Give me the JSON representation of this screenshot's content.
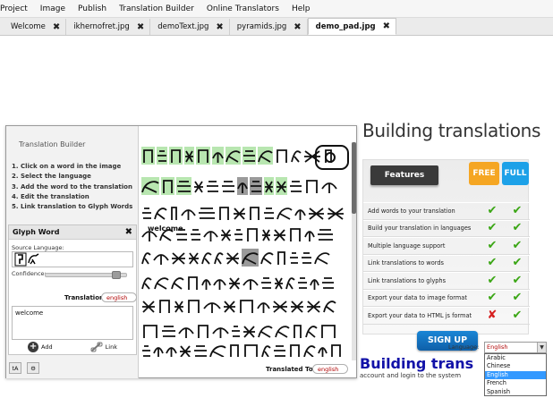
{
  "menu": [
    "Project",
    "Image",
    "Publish",
    "Translation Builder",
    "Online Translators",
    "Help"
  ],
  "tabs": [
    {
      "label": "Welcome",
      "active": false
    },
    {
      "label": "ikhernofret.jpg",
      "active": false
    },
    {
      "label": "demoText.jpg",
      "active": false
    },
    {
      "label": "pyramids.jpg",
      "active": false
    },
    {
      "label": "demo_pad.jpg",
      "active": true
    }
  ],
  "builder": {
    "title": "Translation Builder",
    "steps": [
      "1. Click on a word in the image",
      "2. Select the language",
      "3. Add the word to the translation",
      "4. Edit the translation",
      "5. Link translation to Glyph Words"
    ],
    "glyph_word": {
      "title": "Glyph Word",
      "source_language_label": "Source Language:",
      "confidence_label": "Confidence:",
      "confidence": 0.9,
      "translation_label": "Translation:",
      "translation_language": "english",
      "translation_text": "welcome",
      "add_label": "Add",
      "link_label": "Link"
    },
    "word_tag": "welcome",
    "translated_to_label": "Translated To:",
    "translated_to_value": "english"
  },
  "marketing": {
    "title": "Building translations",
    "features_label": "Features",
    "free_label": "FREE",
    "full_label": "FULL",
    "features": [
      {
        "text": "Add words to your translation",
        "free": true,
        "full": true
      },
      {
        "text": "Build your translation in languages",
        "free": true,
        "full": true
      },
      {
        "text": "Multiple language support",
        "free": true,
        "full": true
      },
      {
        "text": "Link translations to words",
        "free": true,
        "full": true
      },
      {
        "text": "Link translations to glyphs",
        "free": true,
        "full": true
      },
      {
        "text": "Export your data to image format",
        "free": true,
        "full": true
      },
      {
        "text": "Export your data to HTML js format",
        "free": false,
        "full": true
      }
    ],
    "signup_label": "SIGN UP",
    "language_label": "Language:",
    "language_selected": "English",
    "language_options": [
      "Arabic",
      "Chinese",
      "English",
      "French",
      "Spanish"
    ],
    "bottom_title": "Building trans",
    "bottom_text": "account and login to the system"
  },
  "colors": {
    "check": "#3aa614",
    "cross": "#d62020",
    "free_badge": "#f5a623",
    "full_badge": "#1da1e8",
    "signup": "#1a86d6",
    "glyph_highlight": "#b8e6b0",
    "glyph_selected": "#9a9a9a"
  },
  "icons": {
    "check": "✔",
    "cross": "✘",
    "close": "✖"
  }
}
